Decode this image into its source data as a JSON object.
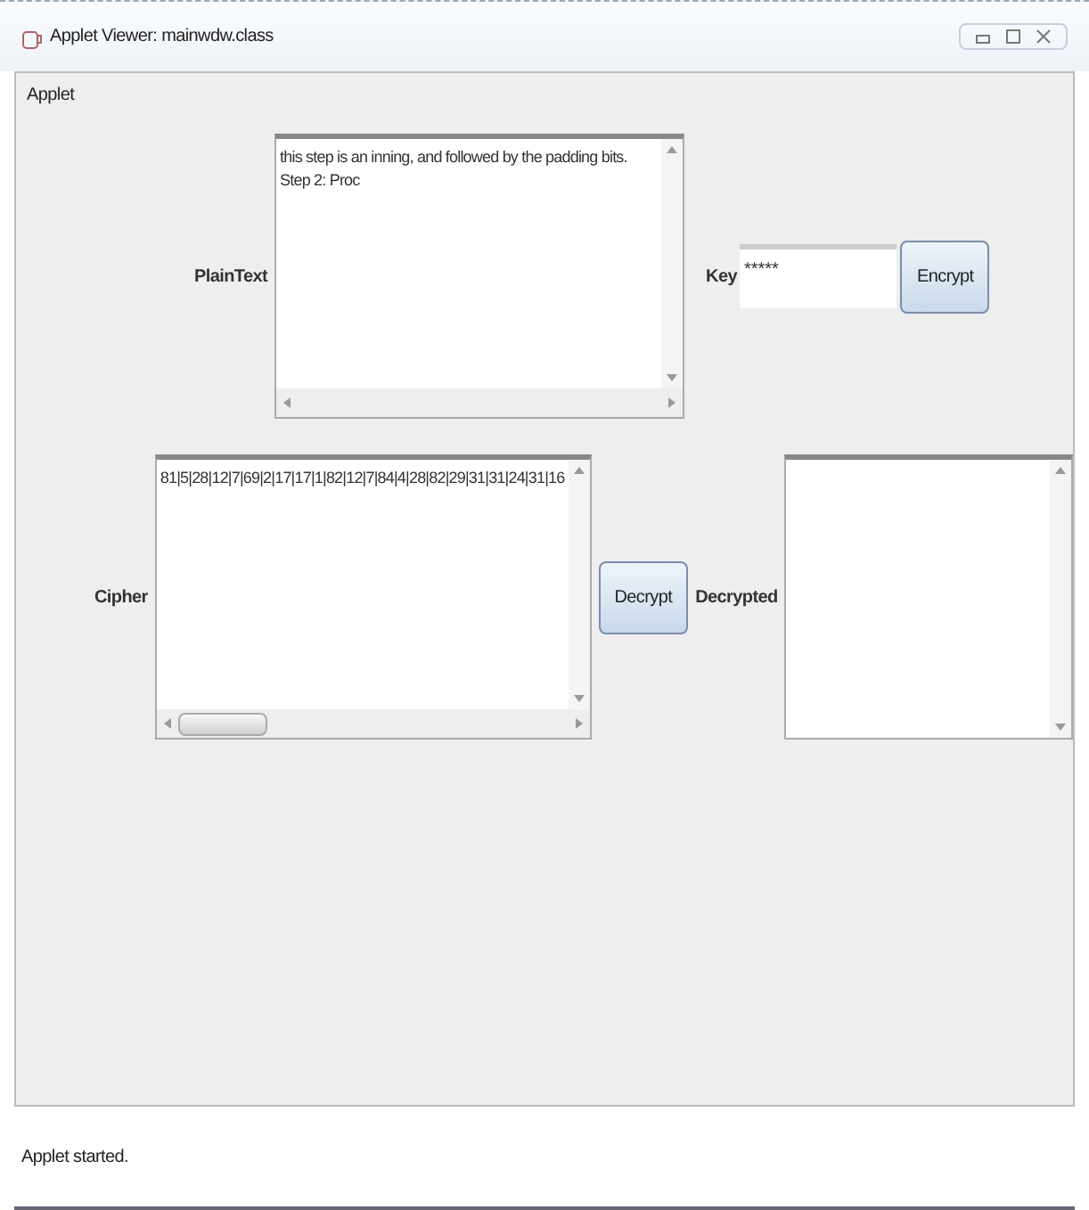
{
  "window": {
    "title": "Applet Viewer: mainwdw.class"
  },
  "menu": {
    "label": "Applet"
  },
  "plaintext": {
    "label": "PlainText",
    "lines": [
      "this step is an inning, and followed by the padding bits.",
      "Step 2: Proc"
    ]
  },
  "key": {
    "label": "Key",
    "value": "*****"
  },
  "encrypt_button": {
    "label": "Encrypt"
  },
  "cipher": {
    "label": "Cipher",
    "lines": [
      "81|5|28|12|7|69|2|17|17|1|82|12|7|84|4|28|82|29|31|31|24|31|16"
    ]
  },
  "decrypt_button": {
    "label": "Decrypt"
  },
  "decrypted": {
    "label": "Decrypted"
  },
  "status_bar": {
    "text": "Applet started."
  }
}
